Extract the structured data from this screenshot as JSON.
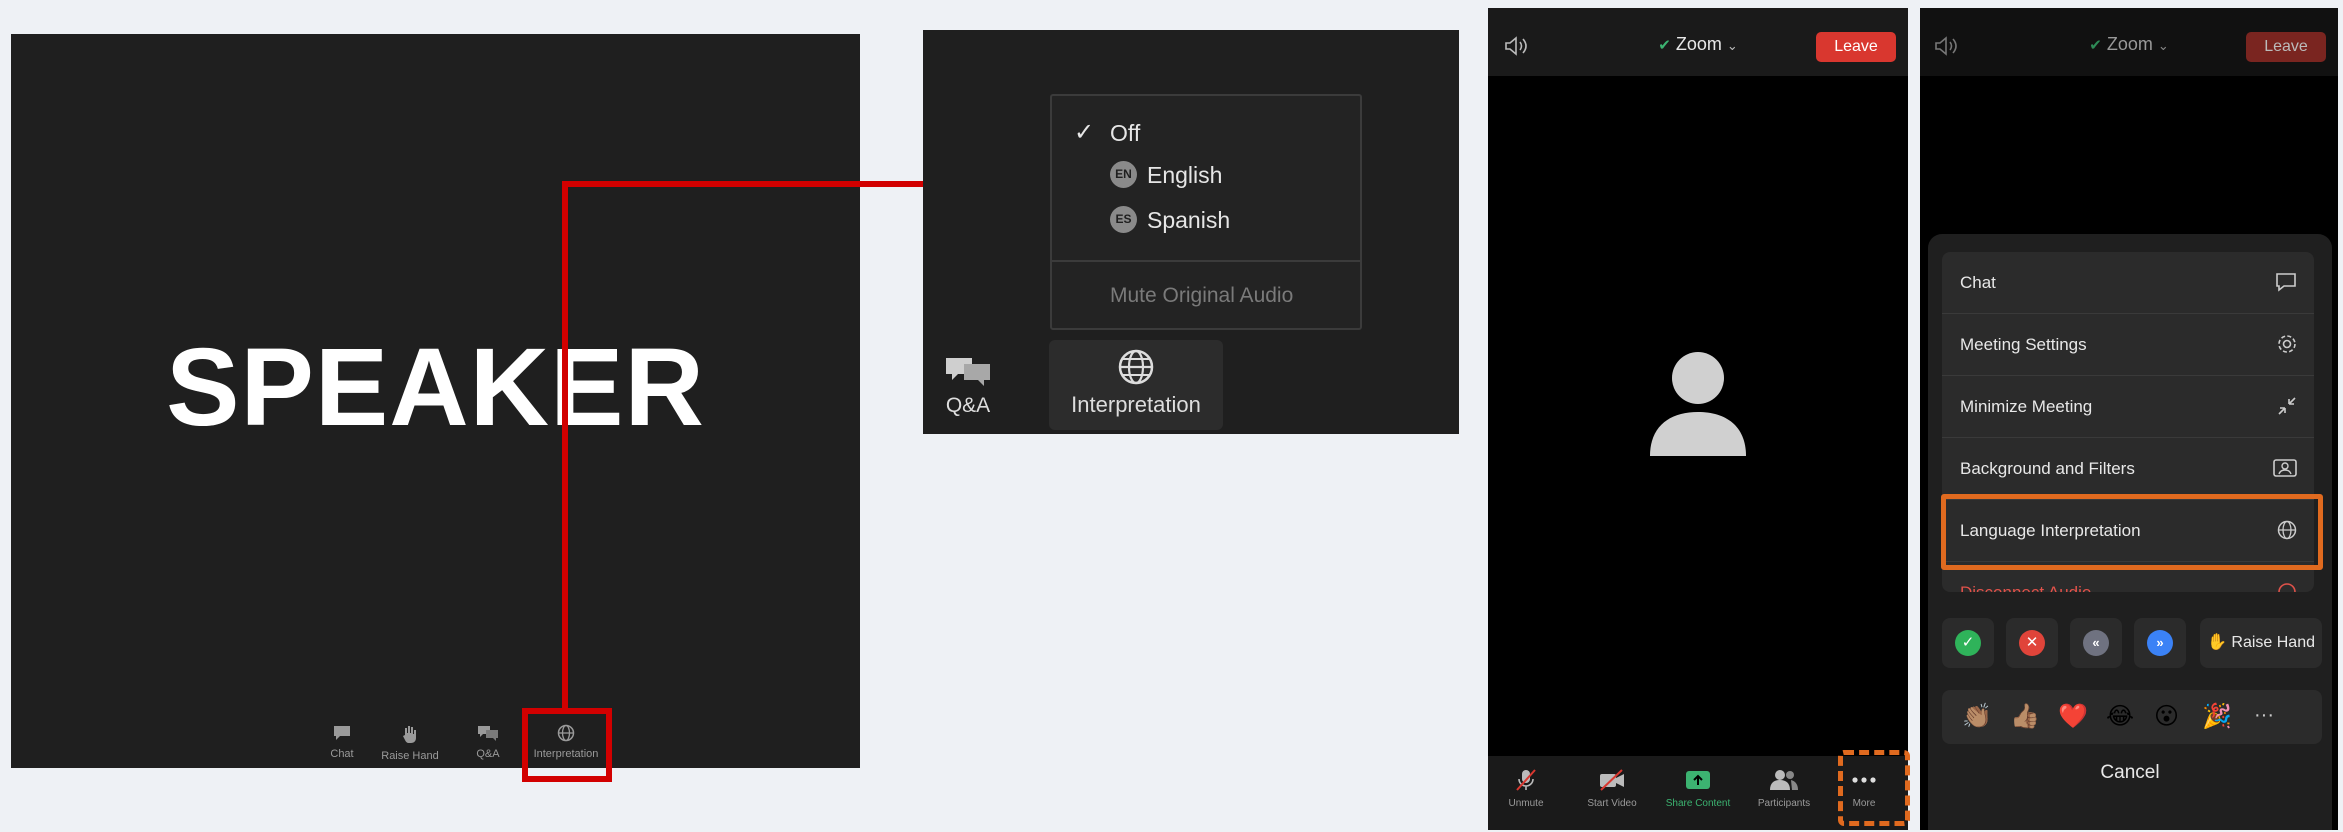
{
  "panel1": {
    "speaker_label": "SPEAKER",
    "toolbar": [
      {
        "label": "Chat",
        "icon": "chat-icon"
      },
      {
        "label": "Raise Hand",
        "icon": "hand-icon"
      },
      {
        "label": "Q&A",
        "icon": "qa-icon"
      },
      {
        "label": "Interpretation",
        "icon": "globe-icon"
      }
    ]
  },
  "panel2": {
    "menu": {
      "off": "Off",
      "english_badge": "EN",
      "english": "English",
      "spanish_badge": "ES",
      "spanish": "Spanish",
      "mute_original": "Mute Original Audio"
    },
    "qa_label": "Q&A",
    "interpretation_label": "Interpretation"
  },
  "panel3": {
    "title": "Zoom",
    "leave": "Leave",
    "bottom_bar": [
      {
        "label": "Unmute",
        "icon": "mic-off-icon"
      },
      {
        "label": "Start Video",
        "icon": "video-off-icon"
      },
      {
        "label": "Share Content",
        "icon": "share-icon"
      },
      {
        "label": "Participants",
        "icon": "participants-icon"
      },
      {
        "label": "More",
        "icon": "more-icon"
      }
    ]
  },
  "panel4": {
    "title": "Zoom",
    "leave": "Leave",
    "menu_items": [
      {
        "label": "Chat",
        "icon": "chat-icon"
      },
      {
        "label": "Meeting Settings",
        "icon": "gear-icon"
      },
      {
        "label": "Minimize Meeting",
        "icon": "minimize-icon"
      },
      {
        "label": "Background and Filters",
        "icon": "background-icon"
      },
      {
        "label": "Language Interpretation",
        "icon": "globe-icon"
      },
      {
        "label": "Disconnect Audio",
        "icon": "disconnect-icon"
      }
    ],
    "reaction_buttons": [
      "yes-icon",
      "no-icon",
      "slower-icon",
      "faster-icon"
    ],
    "raise_hand": "✋ Raise Hand",
    "emojis": [
      "👏🏽",
      "👍🏽",
      "❤️",
      "😂",
      "😮",
      "🎉",
      "···"
    ],
    "cancel": "Cancel"
  },
  "colors": {
    "annotation_red": "#d20000",
    "annotation_orange": "#e06a1f",
    "leave_red": "#d9372f",
    "share_green": "#3cb371"
  }
}
